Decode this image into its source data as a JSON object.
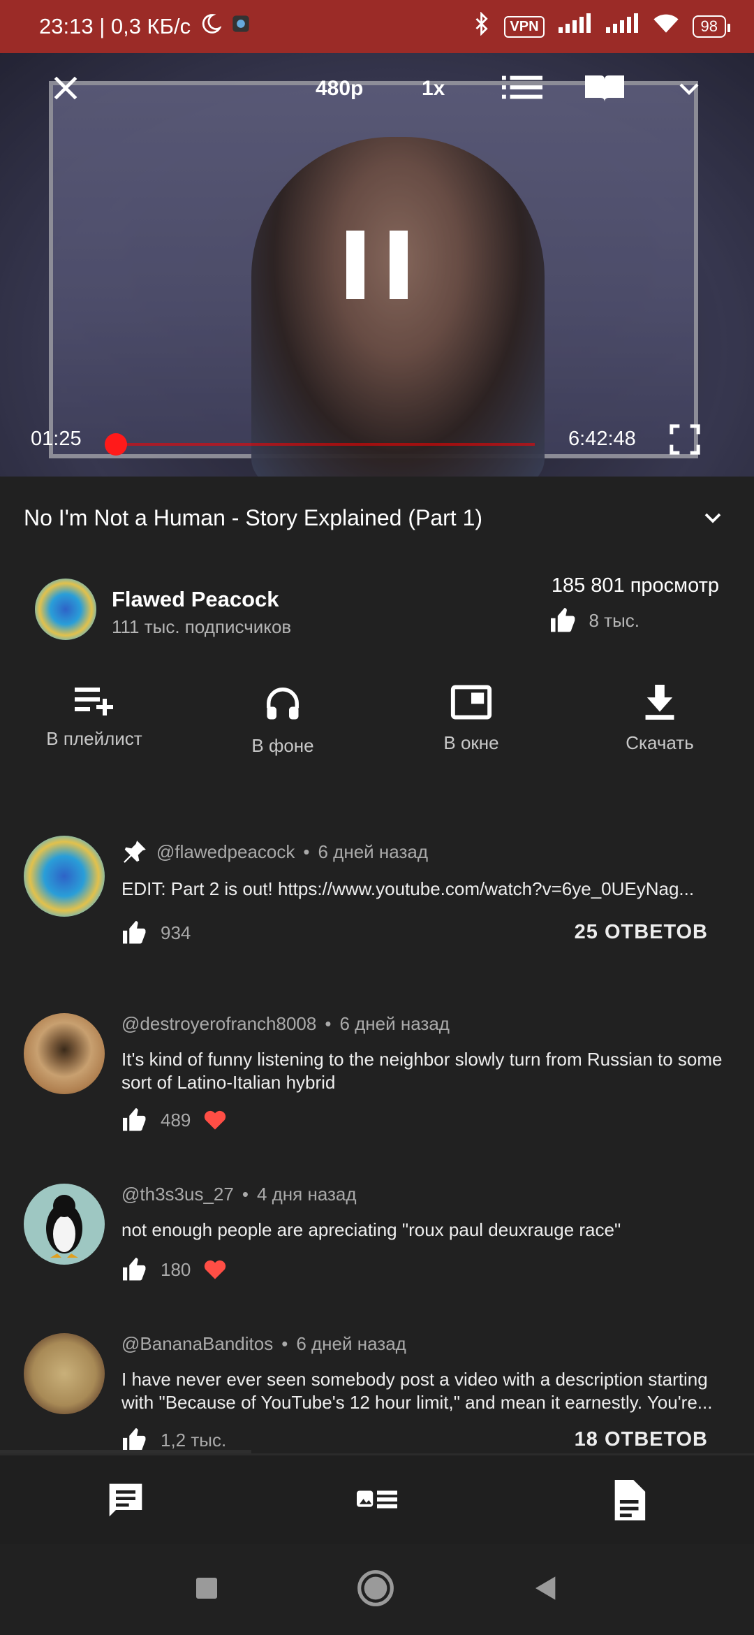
{
  "status_bar": {
    "time_speed": "23:13 | 0,3 КБ/с",
    "vpn": "VPN",
    "battery": "98",
    "icons": [
      "moon-icon",
      "app-icon",
      "bluetooth-icon",
      "signal-icon",
      "signal-icon",
      "wifi-icon"
    ]
  },
  "player": {
    "quality": "480p",
    "speed": "1x",
    "current_time": "01:25",
    "duration": "6:42:48",
    "progress_fraction": 0.0035
  },
  "video": {
    "title": "No I'm Not a Human - Story Explained (Part 1)"
  },
  "channel": {
    "name": "Flawed Peacock",
    "subscribers": "111 тыс. подписчиков",
    "views": "185 801 просмотр",
    "likes": "8 тыс."
  },
  "actions": [
    {
      "label": "В плейлист",
      "icon": "playlist-add-icon"
    },
    {
      "label": "В фоне",
      "icon": "headphones-icon"
    },
    {
      "label": "В окне",
      "icon": "picture-in-picture-icon"
    },
    {
      "label": "Скачать",
      "icon": "download-icon"
    }
  ],
  "comments": [
    {
      "author": "@flawedpeacock",
      "age": "6 дней назад",
      "pinned": true,
      "text": "EDIT: Part 2 is out! https://www.youtube.com/watch?v=6ye_0UEyNag...",
      "likes": "934",
      "replies": "25 ОТВЕТОВ"
    },
    {
      "author": "@destroyerofranch8008",
      "age": "6 дней назад",
      "text": "It's kind of funny listening to the neighbor slowly turn from Russian to some sort of Latino-Italian hybrid",
      "likes": "489",
      "hearted": true
    },
    {
      "author": "@th3s3us_27",
      "age": "4 дня назад",
      "text": "not enough people are apreciating \"roux paul deuxrauge race\"",
      "likes": "180",
      "hearted": true
    },
    {
      "author": "@BananaBanditos",
      "age": "6 дней назад",
      "text": "I have never ever seen somebody post a video with a description starting with \"Because of YouTube's 12 hour limit,\" and mean it earnestly. You're...",
      "likes": "1,2 тыс.",
      "replies": "18 ОТВЕТОВ"
    }
  ],
  "colors": {
    "status_bar": "#9b2b27",
    "background": "#212121",
    "accent_red": "#ff1a1a",
    "heart": "#ff4e45"
  }
}
